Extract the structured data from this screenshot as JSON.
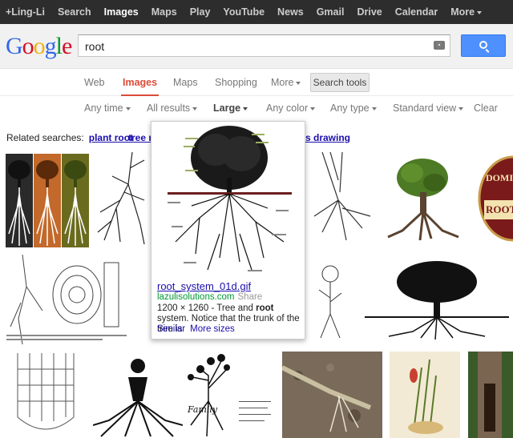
{
  "topbar": {
    "items": [
      "+Ling-Li",
      "Search",
      "Images",
      "Maps",
      "Play",
      "YouTube",
      "News",
      "Gmail",
      "Drive",
      "Calendar",
      "More"
    ],
    "active_index": 2
  },
  "logo": {
    "letters": [
      "G",
      "o",
      "o",
      "g",
      "l",
      "e"
    ],
    "colors": [
      "#3369e8",
      "#d50f25",
      "#eeb211",
      "#3369e8",
      "#009925",
      "#d50f25"
    ]
  },
  "search": {
    "query": "root"
  },
  "tabs": {
    "items": [
      "Web",
      "Images",
      "Maps",
      "Shopping",
      "More"
    ],
    "active_index": 1,
    "tools_label": "Search tools"
  },
  "filters": {
    "items": [
      "Any time",
      "All results",
      "Large",
      "Any color",
      "Any type",
      "Standard view",
      "Clear"
    ]
  },
  "related": {
    "label": "Related searches:",
    "items": [
      "plant root",
      "tree r",
      "s drawing"
    ]
  },
  "popup": {
    "title": "root_system_01d.gif",
    "site": "lazulisolutions.com",
    "share": "Share",
    "desc_before": "1200 × 1260 - Tree and ",
    "desc_bold": "root",
    "desc_after": " system. Notice that the trunk of the tree is",
    "similar": "Similar",
    "more_sizes": "More sizes"
  },
  "thumb": {
    "dominion_text": "DOMIN",
    "root_text": "ROOT B",
    "family_text": "Family"
  },
  "colors": {
    "accent_red": "#dd4b39",
    "link": "#1a0dab",
    "url_green": "#093",
    "search_blue": "#4d90fe",
    "topbar": "#2d2d2d"
  }
}
